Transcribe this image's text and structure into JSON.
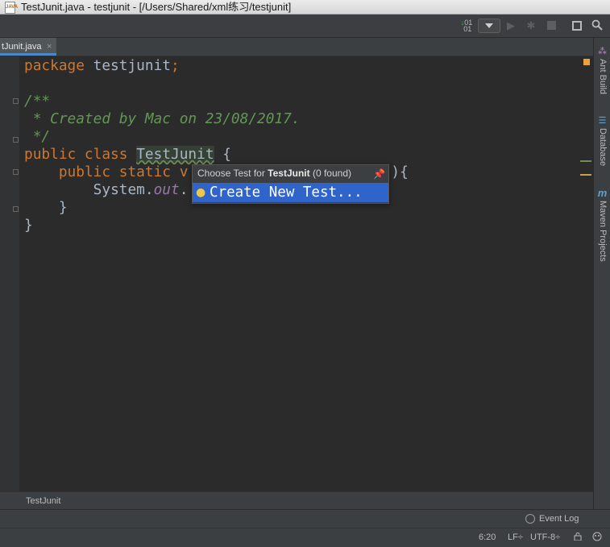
{
  "window": {
    "title": "TestJunit.java - testjunit - [/Users/Shared/xml练习/testjunit]",
    "file_icon": "java-file-icon"
  },
  "toolbar": {
    "icons": [
      "sort-icon",
      "run-config-dropdown",
      "run-icon",
      "debug-icon",
      "stop-icon",
      "project-structure-icon",
      "search-icon"
    ]
  },
  "tab": {
    "label": "tJunit.java",
    "close": "×"
  },
  "code": {
    "line1_kw": "package",
    "line1_rest": " testjunit",
    "line1_semi": ";",
    "line3": "/**",
    "line4": " * Created by Mac on 23/08/2017.",
    "line5": " */",
    "line6_kw": "public class",
    "line6_class": "TestJunit",
    "line6_brace": " {",
    "line7_kw": "public static v",
    "line7_rest": ")",
    "line7_brace": "{",
    "line8_a": "System.",
    "line8_field": "out",
    "line8_b": ".",
    "line9": "}",
    "line10": "}"
  },
  "popup": {
    "header_prefix": "Choose Test for ",
    "header_class": "TestJunit",
    "header_suffix": " (0 found)",
    "pin_icon": "pin-icon",
    "item_label": "Create New Test...",
    "item_icon": "lightbulb-icon"
  },
  "right_tools": [
    {
      "label": "Ant Build",
      "icon": "ant-icon"
    },
    {
      "label": "Database",
      "icon": "database-icon"
    },
    {
      "label": "Maven Projects",
      "icon": "maven-icon"
    }
  ],
  "right_tool_glyphs": {
    "ant": "⁂",
    "database": "☰",
    "maven": "m"
  },
  "breadcrumb": "TestJunit",
  "event_log": "Event Log",
  "status": {
    "position": "6:20",
    "line_sep": "LF÷",
    "encoding": "UTF-8÷"
  },
  "colors": {
    "keyword": "#cc7832",
    "comment": "#629755",
    "field": "#9876aa",
    "selection": "#2f65ca",
    "warning": "#e6a23c"
  }
}
